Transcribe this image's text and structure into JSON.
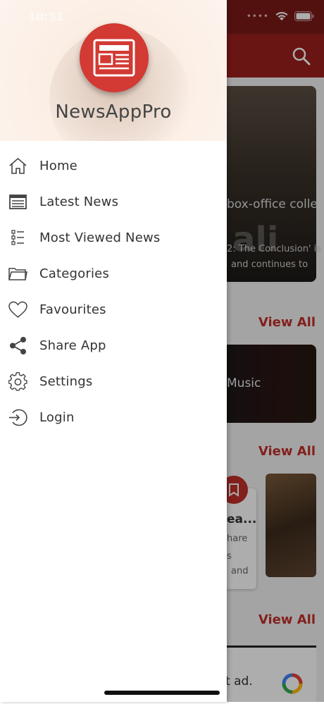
{
  "status_bar": {
    "time": "10:51"
  },
  "background_app": {
    "card1_headline": "box-office colle",
    "card1_desc_line1": "2: The Conclusion' is",
    "card1_desc_line2": "and continues to",
    "card1_watermark": "ali",
    "section_links": [
      "View All",
      "View All",
      "View All"
    ],
    "card2_label": "Music",
    "small_card_title": "ea...",
    "small_card_line1": "hare",
    "small_card_line2": "s",
    "small_card_line3": "and",
    "ad_text": "t ad."
  },
  "drawer": {
    "app_name": "NewsAppPro",
    "menu": [
      {
        "label": "Home",
        "icon": "home-icon"
      },
      {
        "label": "Latest News",
        "icon": "newspaper-icon"
      },
      {
        "label": "Most Viewed News",
        "icon": "list-icon"
      },
      {
        "label": "Categories",
        "icon": "folder-icon"
      },
      {
        "label": "Favourites",
        "icon": "heart-icon"
      },
      {
        "label": "Share App",
        "icon": "share-icon"
      },
      {
        "label": "Settings",
        "icon": "gear-icon"
      },
      {
        "label": "Login",
        "icon": "login-icon"
      }
    ]
  },
  "colors": {
    "accent": "#c0302a",
    "logo": "#d23a33",
    "text": "#333333"
  }
}
